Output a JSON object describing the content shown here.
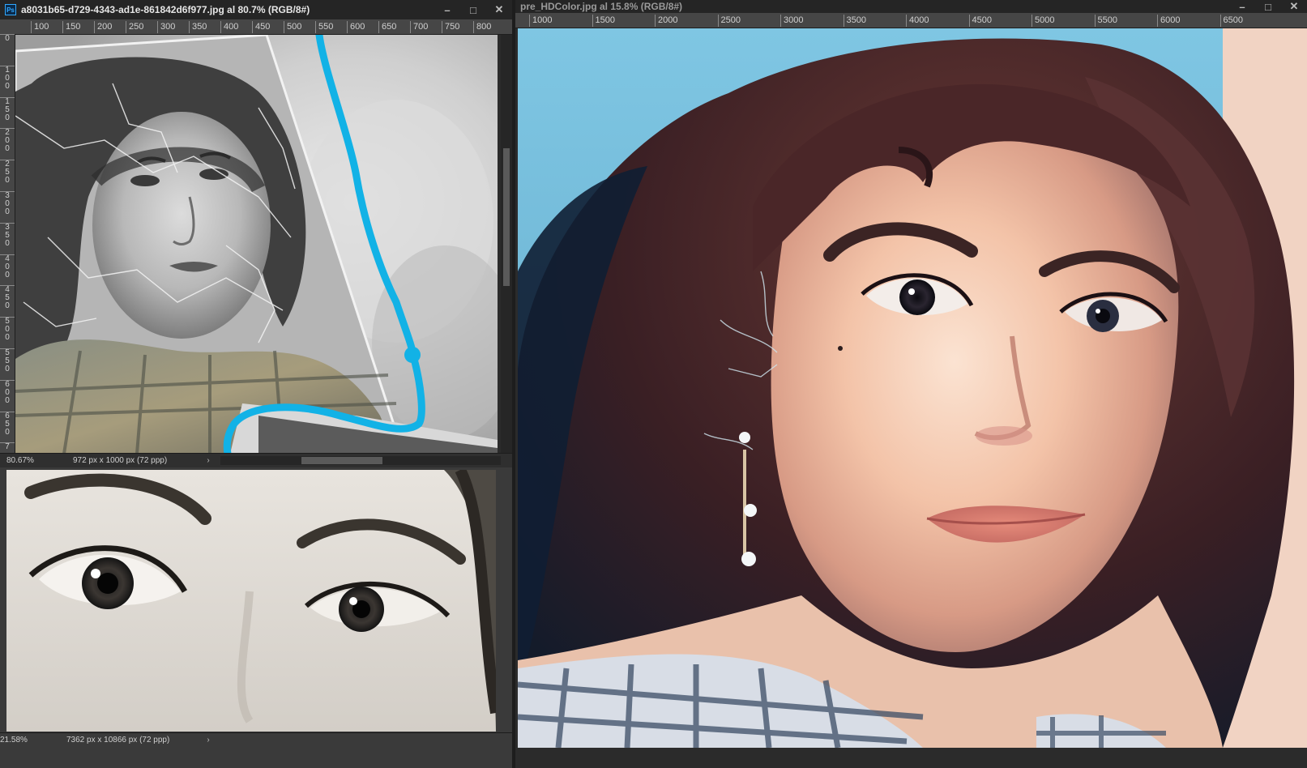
{
  "windows": {
    "source": {
      "title": "a8031b65-d729-4343-ad1e-861842d6f977.jpg al 80.7% (RGB/8#)",
      "app_badge": "Ps",
      "ruler_h": [
        "100",
        "150",
        "200",
        "250",
        "300",
        "350",
        "400",
        "450",
        "500",
        "550",
        "600",
        "650",
        "700",
        "750",
        "800"
      ],
      "ruler_v": [
        "0",
        "1 0 0",
        "1 5 0",
        "2 0 0",
        "2 5 0",
        "3 0 0",
        "3 5 0",
        "4 0 0",
        "4 5 0",
        "5 0 0",
        "5 5 0",
        "6 0 0",
        "6 5 0",
        "7"
      ],
      "zoom": "80.67%",
      "dimensions": "972 px x 1000 px (72 ppp)"
    },
    "reference": {
      "zoom": "21.58%",
      "dimensions": "7362 px x 10866 px (72 ppp)"
    },
    "result": {
      "title": "pre_HDColor.jpg al 15.8% (RGB/8#)",
      "ruler_h": [
        "1000",
        "1500",
        "2000",
        "2500",
        "3000",
        "3500",
        "4000",
        "4500",
        "5000",
        "5500",
        "6000",
        "6500"
      ]
    }
  },
  "window_controls": {
    "minimize": "–",
    "maximize": "□",
    "close": "✕",
    "arrow_right": "›",
    "arrow_left": "‹"
  },
  "colors": {
    "brush_stroke": "#12b2e6",
    "ps_accent": "#31a8ff"
  }
}
